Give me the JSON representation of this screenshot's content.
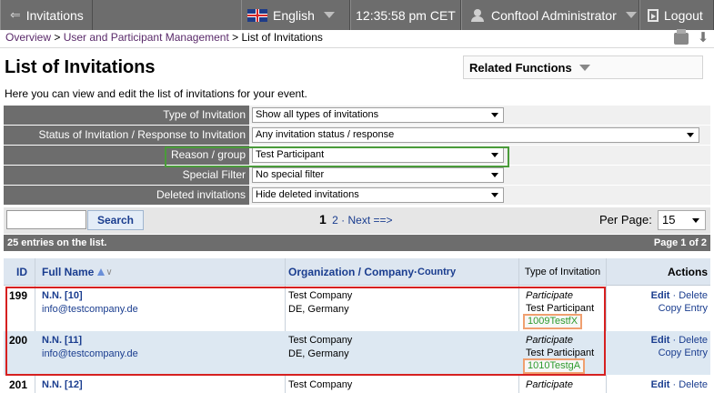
{
  "topbar": {
    "invitations_label": "Invitations",
    "language": "English",
    "time": "12:35:58 pm CET",
    "user": "Conftool Administrator",
    "logout_label": "Logout"
  },
  "breadcrumb": {
    "overview": "Overview",
    "sep1": " > ",
    "user_mgmt": "User and Participant Management",
    "sep2": " > ",
    "current": "List of Invitations"
  },
  "page": {
    "title": "List of Invitations",
    "related_functions": "Related Functions",
    "intro": "Here you can view and edit the list of invitations for your event."
  },
  "filters": [
    {
      "label": "Type of Invitation",
      "value": "Show all types of invitations"
    },
    {
      "label": "Status of Invitation / Response to Invitation",
      "value": "Any invitation status / response"
    },
    {
      "label": "Reason / group",
      "value": "Test Participant"
    },
    {
      "label": "Special Filter",
      "value": "No special filter"
    },
    {
      "label": "Deleted invitations",
      "value": "Hide deleted invitations"
    }
  ],
  "search": {
    "button_label": "Search",
    "current_page": "1",
    "page2": "2",
    "dot": " · ",
    "next": "Next ==>",
    "per_page_label": "Per Page:",
    "per_page_value": "15"
  },
  "counts": {
    "entries": "25 entries on the list.",
    "page_of": "Page 1 of 2"
  },
  "columns": {
    "id": "ID",
    "full_name": "Full Name",
    "org": "Organization / Company",
    "dot": " · ",
    "country": "Country",
    "type": "Type of Invitation",
    "actions": "Actions"
  },
  "rows": [
    {
      "id": "199",
      "name": "N.N. [10]",
      "email": "info@testcompany.de",
      "org": "Test Company",
      "country": "DE, Germany",
      "type": "Participate",
      "reason": "Test Participant",
      "code": "1009TestfX",
      "edit": "Edit",
      "delete": "Delete",
      "copy": "Copy Entry"
    },
    {
      "id": "200",
      "name": "N.N. [11]",
      "email": "info@testcompany.de",
      "org": "Test Company",
      "country": "DE, Germany",
      "type": "Participate",
      "reason": "Test Participant",
      "code": "1010TestgA",
      "edit": "Edit",
      "delete": "Delete",
      "copy": "Copy Entry"
    },
    {
      "id": "201",
      "name": "N.N. [12]",
      "org": "Test Company",
      "type": "Participate",
      "edit": "Edit",
      "delete": "Delete"
    }
  ],
  "action_sep": " · "
}
